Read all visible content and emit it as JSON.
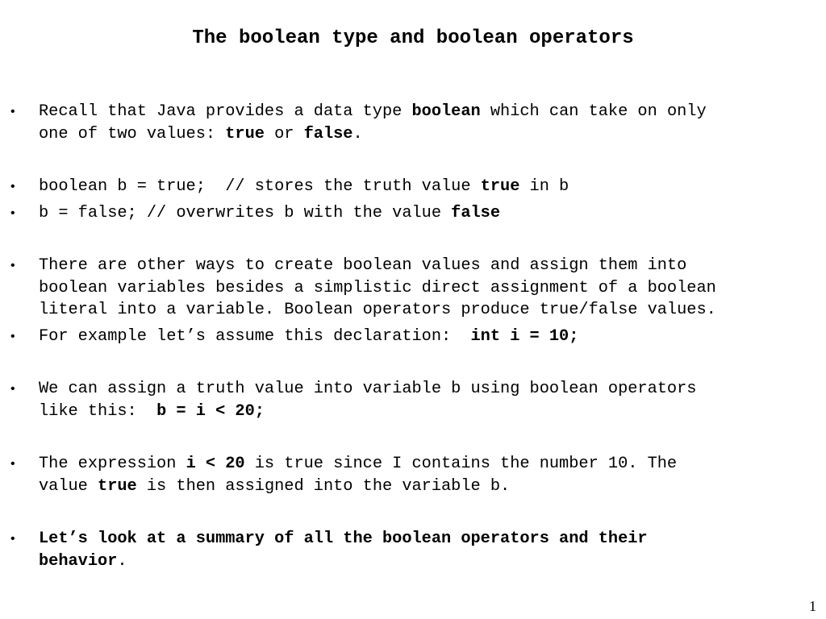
{
  "slide": {
    "title": "The boolean type and boolean operators",
    "page_number": "1",
    "bullet_symbol": "•",
    "bullets": [
      {
        "lines": [
          [
            {
              "t": "Recall that Java provides a data type "
            },
            {
              "t": "boolean",
              "bold": true
            },
            {
              "t": " which can take on only"
            }
          ],
          [
            {
              "t": "one of two values: "
            },
            {
              "t": "true",
              "bold": true
            },
            {
              "t": " or "
            },
            {
              "t": "false",
              "bold": true
            },
            {
              "t": "."
            }
          ]
        ]
      },
      {
        "lines": [
          [
            {
              "t": "boolean b = true;  // stores the truth value "
            },
            {
              "t": "true",
              "bold": true
            },
            {
              "t": " in b"
            }
          ]
        ]
      },
      {
        "lines": [
          [
            {
              "t": "b = false; // overwrites b with the value "
            },
            {
              "t": "false",
              "bold": true
            }
          ]
        ]
      },
      {
        "lines": [
          [
            {
              "t": "There are other ways to create boolean values and assign them into"
            }
          ],
          [
            {
              "t": "boolean variables besides a simplistic direct assignment of a boolean"
            }
          ],
          [
            {
              "t": "literal into a variable. Boolean operators produce true/false values."
            }
          ]
        ]
      },
      {
        "lines": [
          [
            {
              "t": "For example let’s assume this declaration:  "
            },
            {
              "t": "int i = 10;",
              "bold": true
            }
          ]
        ]
      },
      {
        "lines": [
          [
            {
              "t": "We can assign a truth value into variable b using boolean operators"
            }
          ],
          [
            {
              "t": "like this:  "
            },
            {
              "t": "b = i < 20;",
              "bold": true
            }
          ]
        ]
      },
      {
        "lines": [
          [
            {
              "t": "The expression "
            },
            {
              "t": "i < 20",
              "bold": true
            },
            {
              "t": " is true since I contains the number 10. The"
            }
          ],
          [
            {
              "t": "value "
            },
            {
              "t": "true",
              "bold": true
            },
            {
              "t": " is then assigned into the variable b."
            }
          ]
        ]
      },
      {
        "lines": [
          [
            {
              "t": "Let’s look at a summary of all the boolean operators and their",
              "bold": true
            }
          ],
          [
            {
              "t": "behavior",
              "bold": true
            },
            {
              "t": "."
            }
          ]
        ]
      }
    ]
  }
}
